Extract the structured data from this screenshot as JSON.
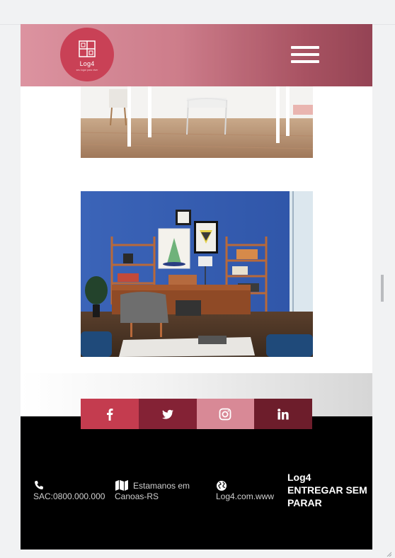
{
  "header": {
    "logo_text": "Log4",
    "logo_tagline": "seu lugar para viver",
    "menu_icon": "hamburger-menu-icon",
    "gradient_start": "#d98a98",
    "gradient_end": "#8c3446",
    "logo_color": "#c94156"
  },
  "gallery": {
    "images": [
      {
        "subject": "bright room with white desk, glass chair and wooden floor"
      },
      {
        "subject": "home office with blue wall, wooden shelves, desk and armchairs"
      }
    ]
  },
  "social": [
    {
      "name": "facebook",
      "icon": "facebook-icon",
      "color": "#c43c4f"
    },
    {
      "name": "twitter",
      "icon": "twitter-icon",
      "color": "#842235"
    },
    {
      "name": "instagram",
      "icon": "instagram-icon",
      "color": "#d88996"
    },
    {
      "name": "linkedin",
      "icon": "linkedin-icon",
      "color": "#6d1d2b"
    }
  ],
  "footer": {
    "phone": "SAC:0800.000.000",
    "address_line1": "Estamanos em",
    "address_line2": "Canoas-RS",
    "website": "Log4.com.www",
    "brand_line1": "Log4",
    "brand_line2": "ENTREGAR SEM",
    "brand_line3": "PARAR",
    "background": "#000000"
  }
}
